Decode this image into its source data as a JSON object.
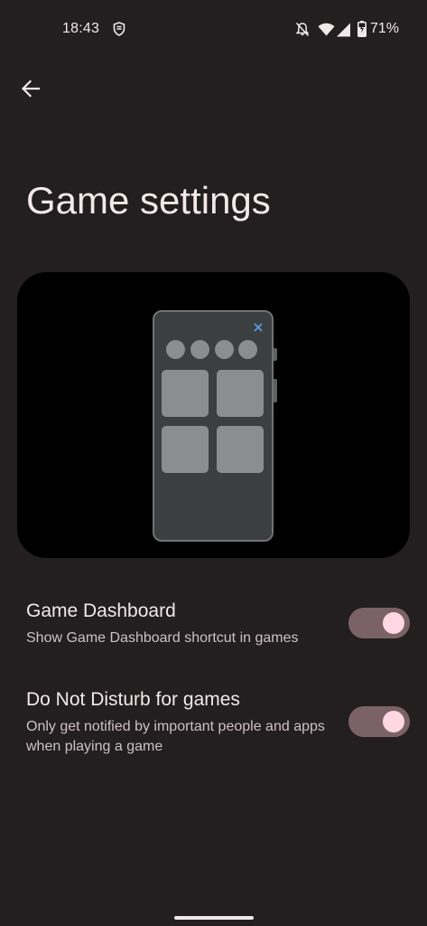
{
  "status_bar": {
    "time": "18:43",
    "battery": "71%",
    "icons": [
      "shield-icon",
      "dnd-muted-bell-icon",
      "wifi-icon",
      "cell-signal-icon",
      "battery-charging-icon"
    ]
  },
  "header": {
    "back_icon": "arrow-back-icon",
    "title": "Game settings"
  },
  "preview": {
    "close_icon": "close-icon",
    "accent_color": "#5b9be0"
  },
  "settings": [
    {
      "title": "Game Dashboard",
      "subtitle": "Show Game Dashboard shortcut in games",
      "enabled": true
    },
    {
      "title": "Do Not Disturb for games",
      "subtitle": "Only get notified by important people and apps when playing a game",
      "enabled": true
    }
  ],
  "colors": {
    "background": "#231e1f",
    "toggle_track_on": "#7b6268",
    "toggle_thumb_on": "#ffd8e3"
  }
}
